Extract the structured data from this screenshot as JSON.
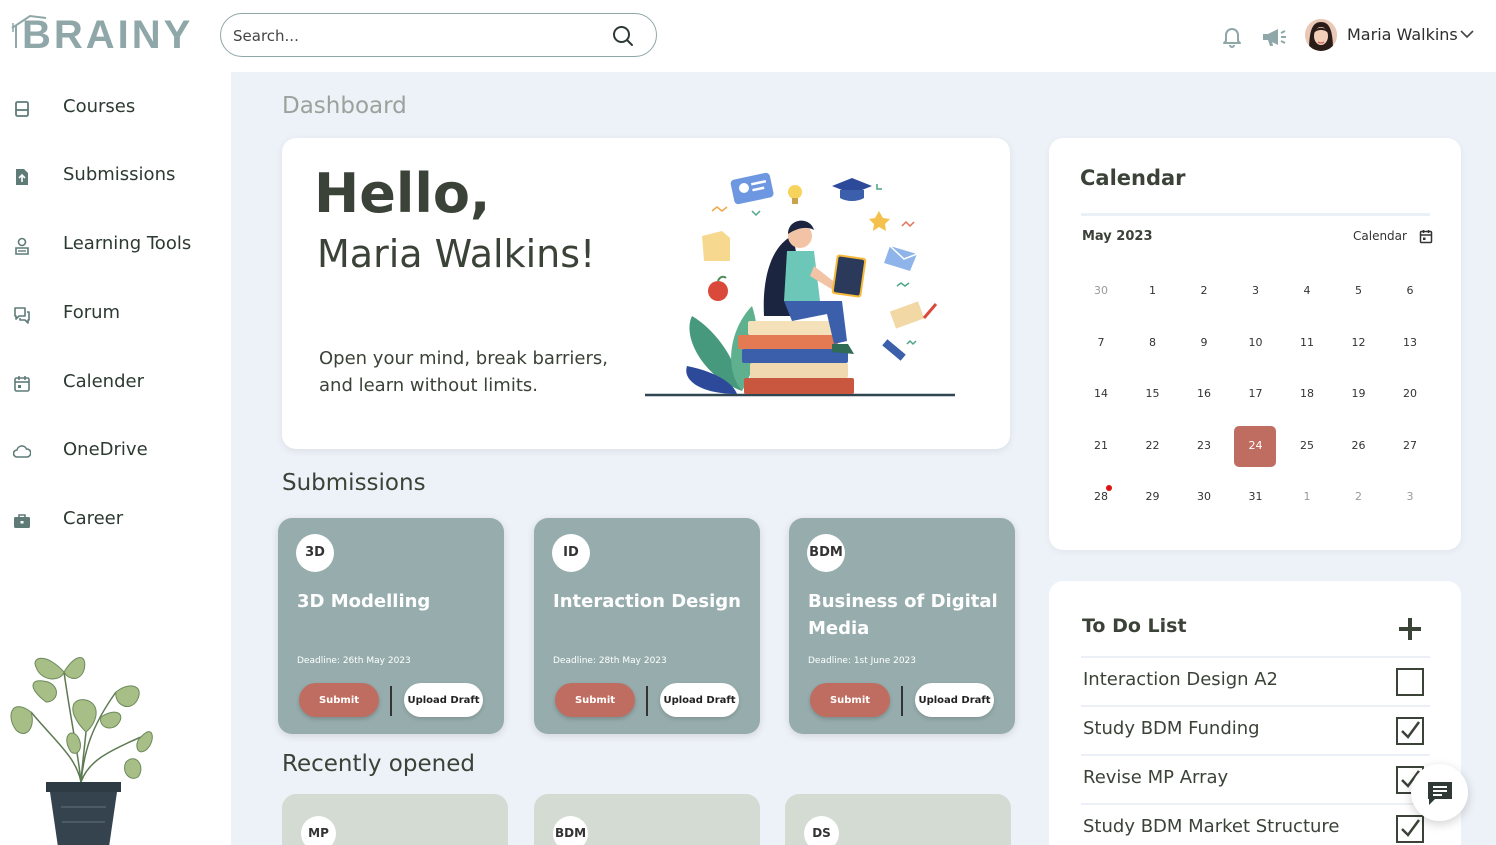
{
  "header": {
    "logo_text": "BRAINY",
    "search_placeholder": "Search...",
    "user_name": "Maria Walkins"
  },
  "sidebar": {
    "items": [
      {
        "label": "Courses",
        "icon": "courses-icon"
      },
      {
        "label": "Submissions",
        "icon": "submissions-icon"
      },
      {
        "label": "Learning Tools",
        "icon": "learning-tools-icon"
      },
      {
        "label": "Forum",
        "icon": "forum-icon"
      },
      {
        "label": "Calender",
        "icon": "calendar-icon"
      },
      {
        "label": "OneDrive",
        "icon": "cloud-icon"
      },
      {
        "label": "Career",
        "icon": "briefcase-icon"
      }
    ]
  },
  "main": {
    "page_title": "Dashboard",
    "hero": {
      "greeting": "Hello,",
      "name": "Maria Walkins!",
      "tagline": "Open your mind, break barriers, and learn without limits."
    },
    "submissions_title": "Submissions",
    "submissions": [
      {
        "badge": "3D",
        "title": "3D Modelling",
        "deadline": "Deadline: 26th May 2023",
        "submit_label": "Submit",
        "draft_label": "Upload Draft"
      },
      {
        "badge": "ID",
        "title": "Interaction Design",
        "deadline": "Deadline: 28th May 2023",
        "submit_label": "Submit",
        "draft_label": "Upload Draft"
      },
      {
        "badge": "BDM",
        "title": "Business of Digital Media",
        "deadline": "Deadline: 1st June 2023",
        "submit_label": "Submit",
        "draft_label": "Upload Draft"
      }
    ],
    "recent_title": "Recently opened",
    "recent": [
      {
        "badge": "MP"
      },
      {
        "badge": "BDM"
      },
      {
        "badge": "DS"
      }
    ]
  },
  "calendar": {
    "title": "Calendar",
    "month": "May 2023",
    "link_label": "Calendar",
    "selected_day": "24",
    "event_day": "28",
    "weeks": [
      [
        "30",
        "1",
        "2",
        "3",
        "4",
        "5",
        "6"
      ],
      [
        "7",
        "8",
        "9",
        "10",
        "11",
        "12",
        "13"
      ],
      [
        "14",
        "15",
        "16",
        "17",
        "18",
        "19",
        "20"
      ],
      [
        "21",
        "22",
        "23",
        "24",
        "25",
        "26",
        "27"
      ],
      [
        "28",
        "29",
        "30",
        "31",
        "1",
        "2",
        "3"
      ]
    ],
    "muted": [
      [
        0,
        0
      ],
      [
        4,
        4
      ],
      [
        4,
        5
      ],
      [
        4,
        6
      ]
    ]
  },
  "todo": {
    "title": "To Do List",
    "items": [
      {
        "text": "Interaction Design A2",
        "checked": false
      },
      {
        "text": "Study BDM Funding",
        "checked": true
      },
      {
        "text": "Revise MP Array",
        "checked": true
      },
      {
        "text": "Study BDM Market Structure",
        "checked": true
      }
    ]
  },
  "colors": {
    "accent_teal": "#97adad",
    "accent_red": "#bf6d60",
    "page_bg": "#edf2f8",
    "recent_card": "#d3dbd3"
  }
}
